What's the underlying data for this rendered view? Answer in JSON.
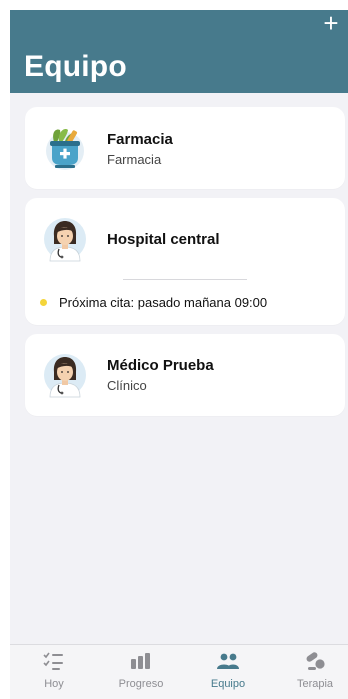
{
  "header": {
    "title": "Equipo",
    "add_label": "+"
  },
  "cards": [
    {
      "name": "Farmacia",
      "subtitle": "Farmacia",
      "icon": "pharmacy-icon"
    },
    {
      "name": "Hospital central",
      "appointment": "Próxima cita: pasado mañana 09:00",
      "icon": "doctor-avatar"
    },
    {
      "name": "Médico Prueba",
      "subtitle": "Clínico",
      "icon": "doctor-avatar"
    }
  ],
  "tabbar": {
    "active_color": "#477a8c",
    "items": [
      {
        "label": "Hoy",
        "icon": "checklist-icon"
      },
      {
        "label": "Progreso",
        "icon": "bar-chart-icon"
      },
      {
        "label": "Equipo",
        "icon": "team-icon"
      },
      {
        "label": "Terapia",
        "icon": "pills-icon"
      }
    ]
  },
  "colors": {
    "header": "#477a8c",
    "background": "#f2f2f6",
    "dot": "#f4d53a"
  }
}
